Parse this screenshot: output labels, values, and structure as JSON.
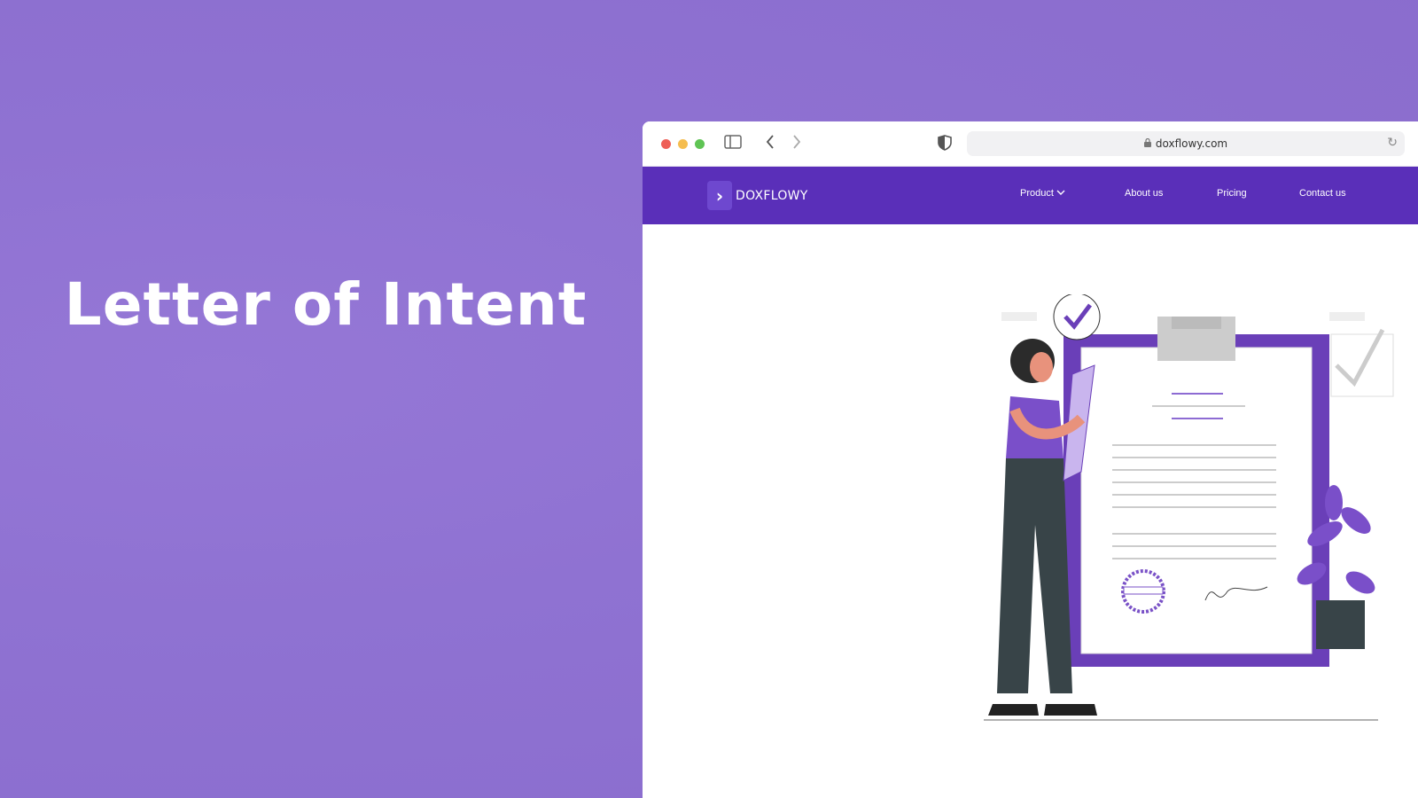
{
  "headline": "Letter of Intent",
  "browser": {
    "url": "doxflowy.com",
    "icons": [
      "close-dot",
      "minimize-dot",
      "maximize-dot",
      "sidebar-icon",
      "back-icon",
      "forward-icon",
      "shield-icon",
      "lock-icon",
      "reload-icon"
    ],
    "traffic_colors": [
      "#ee5f57",
      "#f5bd4f",
      "#5fc454"
    ]
  },
  "site": {
    "brand": "DOXFLOWY",
    "nav_color": "#5a2fb9",
    "nav": [
      {
        "label": "Product",
        "has_dropdown": true
      },
      {
        "label": "About us"
      },
      {
        "label": "Pricing"
      },
      {
        "label": "Contact us"
      }
    ]
  }
}
